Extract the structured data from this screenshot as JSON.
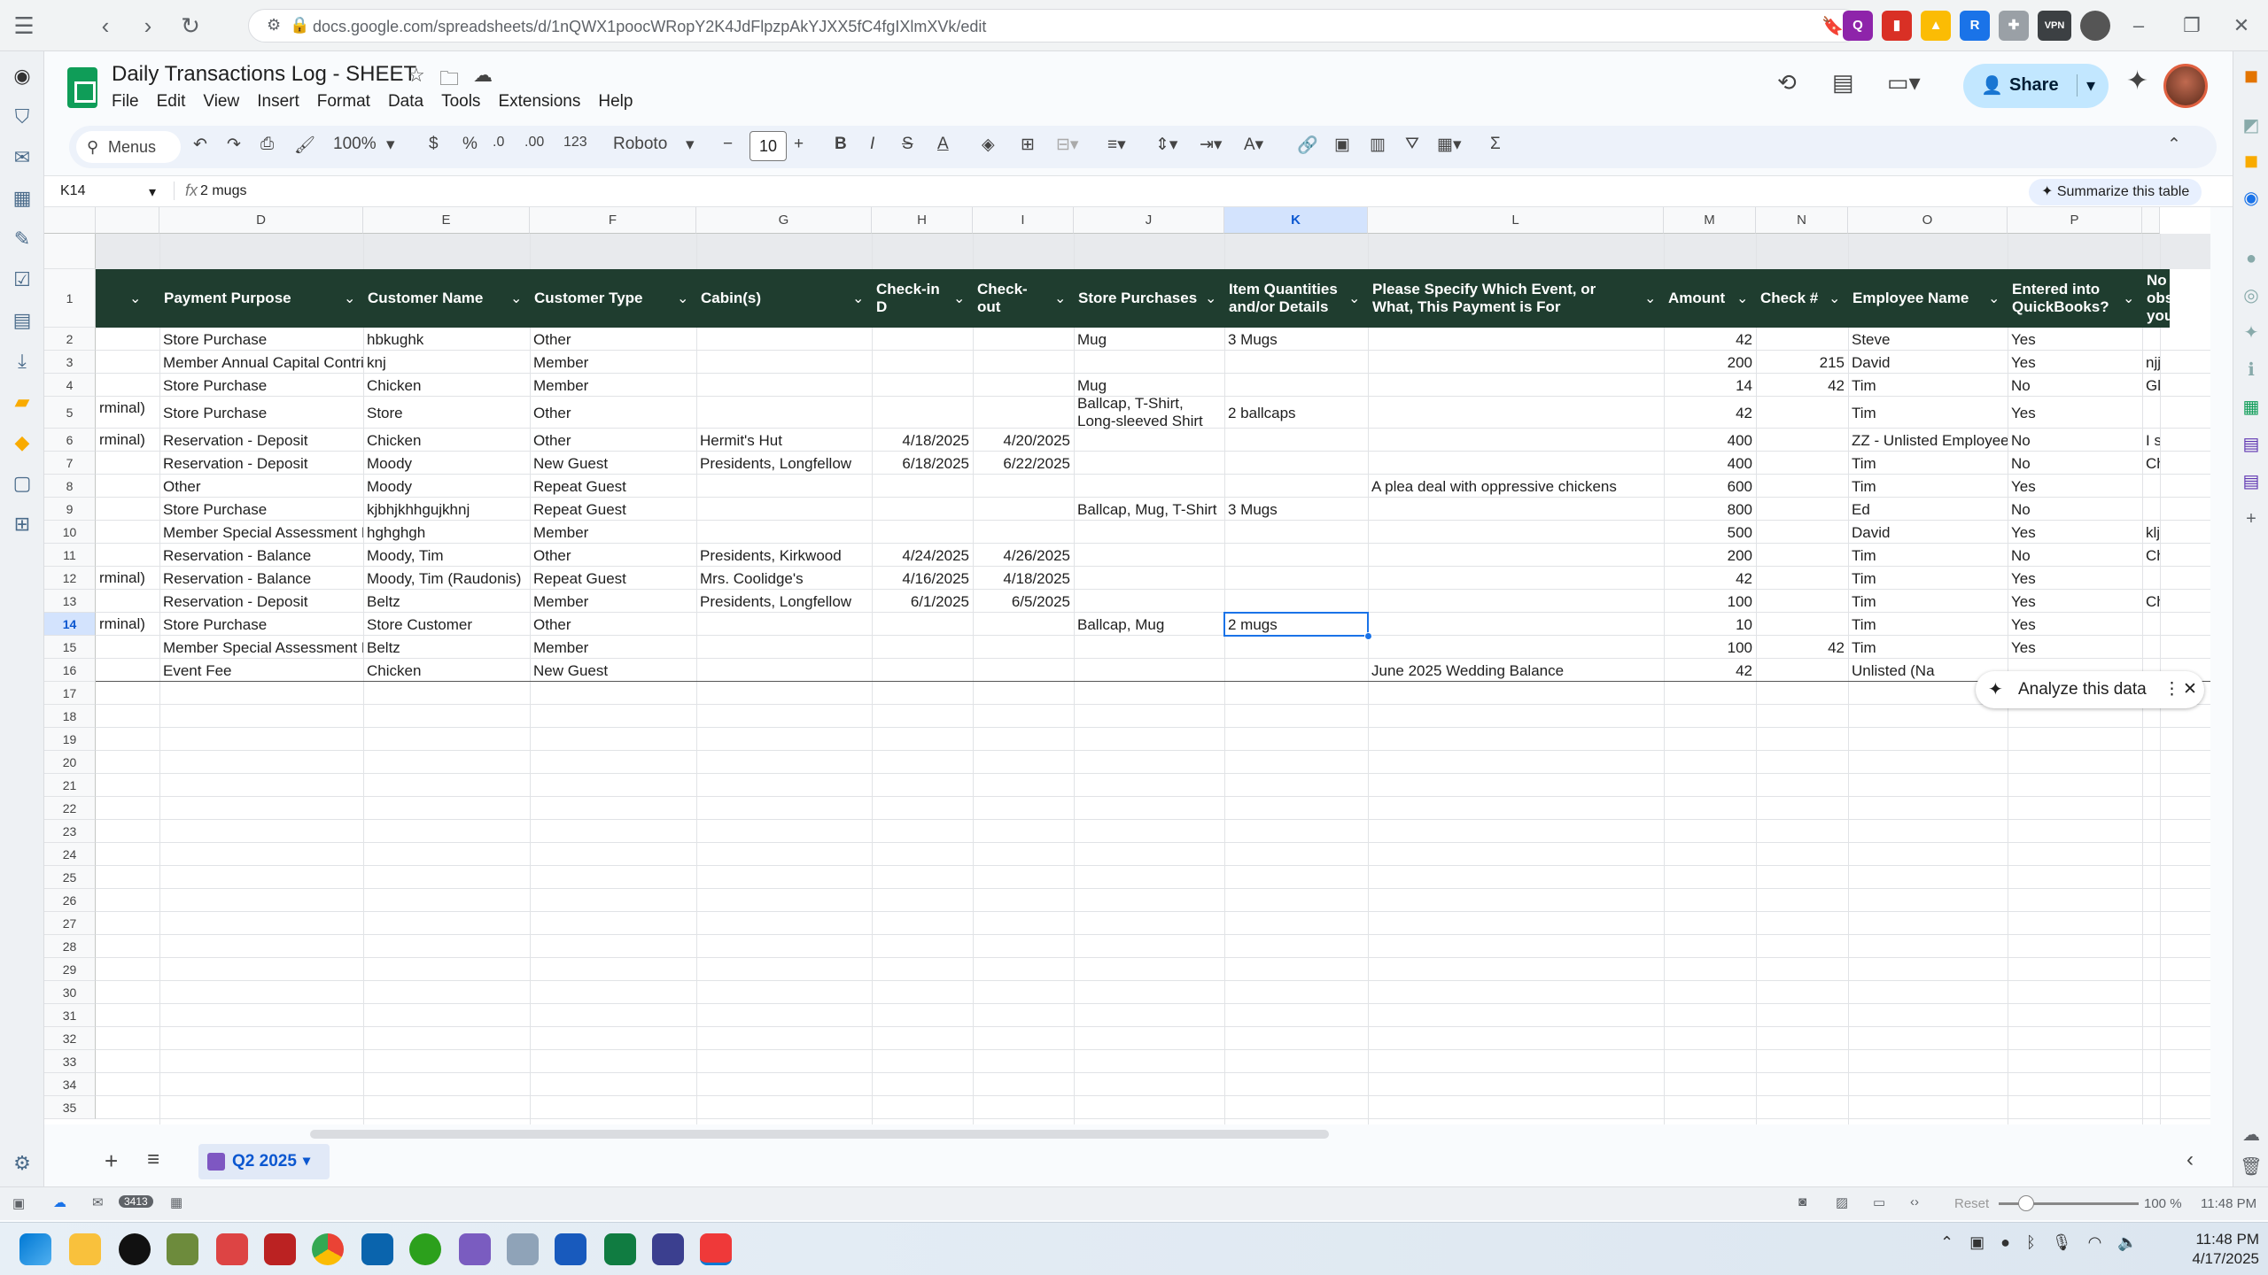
{
  "browser": {
    "url": "docs.google.com/spreadsheets/d/1nQWX1poocWRopY2K4JdFlpzpAkYJXX5fC4fgIXlmXVk/edit",
    "extensions": [
      "VPN"
    ]
  },
  "doc": {
    "title": "Daily Transactions Log - SHEET",
    "menus": [
      "File",
      "Edit",
      "View",
      "Insert",
      "Format",
      "Data",
      "Tools",
      "Extensions",
      "Help"
    ],
    "share_label": "Share"
  },
  "toolbar": {
    "menus_label": "Menus",
    "zoom": "100%",
    "currency": "$",
    "percent": "%",
    "dec_less": ".0",
    "dec_more": ".00",
    "num_format": "123",
    "font": "Roboto",
    "font_size": "10",
    "bold": "B",
    "italic": "I",
    "sum": "Σ"
  },
  "formula_bar": {
    "cell_ref": "K14",
    "fx": "fx",
    "content": "2 mugs",
    "summarize_label": "Summarize this table"
  },
  "grid": {
    "columns": [
      {
        "letter": "D",
        "header": "Payment Purpose"
      },
      {
        "letter": "E",
        "header": "Customer Name"
      },
      {
        "letter": "F",
        "header": "Customer Type"
      },
      {
        "letter": "G",
        "header": "Cabin(s)"
      },
      {
        "letter": "H",
        "header": "Check-in D"
      },
      {
        "letter": "I",
        "header": "Check-out"
      },
      {
        "letter": "J",
        "header": "Store Purchases"
      },
      {
        "letter": "K",
        "header": "Item Quantities and/or Details"
      },
      {
        "letter": "L",
        "header": "Please Specify Which Event, or What, This Payment is For"
      },
      {
        "letter": "M",
        "header": "Amount"
      },
      {
        "letter": "N",
        "header": "Check #"
      },
      {
        "letter": "O",
        "header": "Employee Name"
      },
      {
        "letter": "P",
        "header": "Entered into QuickBooks?"
      },
      {
        "letter": "",
        "header": "No obs you"
      }
    ],
    "selected_column": "K",
    "selected_row": "14",
    "rows": [
      {
        "n": "2",
        "c": "",
        "d": "Store Purchase",
        "e": "hbkughk",
        "f": "Other",
        "g": "",
        "h": "",
        "i": "",
        "j": "Mug",
        "k": "3 Mugs",
        "l": "",
        "m": "42",
        "nn": "",
        "o": "Steve",
        "p": "Yes",
        "q": ""
      },
      {
        "n": "3",
        "c": "",
        "d": "Member Annual Capital Contribution",
        "e": "knj",
        "f": "Member",
        "g": "",
        "h": "",
        "i": "",
        "j": "",
        "k": "",
        "l": "",
        "m": "200",
        "nn": "215",
        "o": "David",
        "p": "Yes",
        "q": "njjh"
      },
      {
        "n": "4",
        "c": "",
        "d": "Store Purchase",
        "e": "Chicken",
        "f": "Member",
        "g": "",
        "h": "",
        "i": "",
        "j": "Mug",
        "k": "",
        "l": "",
        "m": "14",
        "nn": "42",
        "o": "Tim",
        "p": "No",
        "q": "Glit"
      },
      {
        "n": "5",
        "c": "rminal)",
        "d": "Store Purchase",
        "e": "Store",
        "f": "Other",
        "g": "",
        "h": "",
        "i": "",
        "j": "Ballcap, T-Shirt, Long-sleeved Shirt",
        "k": "2 ballcaps",
        "l": "",
        "m": "42",
        "nn": "",
        "o": "Tim",
        "p": "Yes",
        "q": ""
      },
      {
        "n": "6",
        "c": "rminal)",
        "d": "Reservation - Deposit",
        "e": "Chicken",
        "f": "Other",
        "g": "Hermit's Hut",
        "h": "4/18/2025",
        "i": "4/20/2025",
        "j": "",
        "k": "",
        "l": "",
        "m": "400",
        "nn": "",
        "o": "ZZ - Unlisted Employee,",
        "p": "No",
        "q": "I sa"
      },
      {
        "n": "7",
        "c": "",
        "d": "Reservation - Deposit",
        "e": "Moody",
        "f": "New Guest",
        "g": "Presidents, Longfellow",
        "h": "6/18/2025",
        "i": "6/22/2025",
        "j": "",
        "k": "",
        "l": "",
        "m": "400",
        "nn": "",
        "o": "Tim",
        "p": "No",
        "q": "Chi"
      },
      {
        "n": "8",
        "c": "",
        "d": "Other",
        "e": "Moody",
        "f": "Repeat Guest",
        "g": "",
        "h": "",
        "i": "",
        "j": "",
        "k": "",
        "l": "A plea deal with oppressive chickens",
        "m": "600",
        "nn": "",
        "o": "Tim",
        "p": "Yes",
        "q": ""
      },
      {
        "n": "9",
        "c": "",
        "d": "Store Purchase",
        "e": "kjbhjkhhgujkhnj",
        "f": "Repeat Guest",
        "g": "",
        "h": "",
        "i": "",
        "j": "Ballcap, Mug, T-Shirt",
        "k": "3 Mugs",
        "l": "",
        "m": "800",
        "nn": "",
        "o": "Ed",
        "p": "No",
        "q": ""
      },
      {
        "n": "10",
        "c": "",
        "d": "Member Special Assessment Fee",
        "e": "hghghgh",
        "f": "Member",
        "g": "",
        "h": "",
        "i": "",
        "j": "",
        "k": "",
        "l": "",
        "m": "500",
        "nn": "",
        "o": "David",
        "p": "Yes",
        "q": "kljg"
      },
      {
        "n": "11",
        "c": "",
        "d": "Reservation - Balance",
        "e": "Moody, Tim",
        "f": "Other",
        "g": "Presidents, Kirkwood",
        "h": "4/24/2025",
        "i": "4/26/2025",
        "j": "",
        "k": "",
        "l": "",
        "m": "200",
        "nn": "",
        "o": "Tim",
        "p": "No",
        "q": "Chi"
      },
      {
        "n": "12",
        "c": "rminal)",
        "d": "Reservation - Balance",
        "e": "Moody, Tim (Raudonis)",
        "f": "Repeat Guest",
        "g": "Mrs. Coolidge's",
        "h": "4/16/2025",
        "i": "4/18/2025",
        "j": "",
        "k": "",
        "l": "",
        "m": "42",
        "nn": "",
        "o": "Tim",
        "p": "Yes",
        "q": ""
      },
      {
        "n": "13",
        "c": "",
        "d": "Reservation - Deposit",
        "e": "Beltz",
        "f": "Member",
        "g": "Presidents, Longfellow",
        "h": "6/1/2025",
        "i": "6/5/2025",
        "j": "",
        "k": "",
        "l": "",
        "m": "100",
        "nn": "",
        "o": "Tim",
        "p": "Yes",
        "q": "Chi"
      },
      {
        "n": "14",
        "c": "rminal)",
        "d": "Store Purchase",
        "e": "Store Customer",
        "f": "Other",
        "g": "",
        "h": "",
        "i": "",
        "j": "Ballcap, Mug",
        "k": "2 mugs",
        "l": "",
        "m": "10",
        "nn": "",
        "o": "Tim",
        "p": "Yes",
        "q": ""
      },
      {
        "n": "15",
        "c": "",
        "d": "Member Special Assessment Fee",
        "e": "Beltz",
        "f": "Member",
        "g": "",
        "h": "",
        "i": "",
        "j": "",
        "k": "",
        "l": "",
        "m": "100",
        "nn": "42",
        "o": "Tim",
        "p": "Yes",
        "q": ""
      },
      {
        "n": "16",
        "c": "",
        "d": "Event Fee",
        "e": "Chicken",
        "f": "New Guest",
        "g": "",
        "h": "",
        "i": "",
        "j": "",
        "k": "",
        "l": "June 2025 Wedding Balance",
        "m": "42",
        "nn": "",
        "o": "Unlisted (Na",
        "p": "",
        "q": ""
      }
    ],
    "empty_rows": [
      "17",
      "18",
      "19",
      "20",
      "21",
      "22",
      "23",
      "24",
      "25",
      "26",
      "27",
      "28",
      "29",
      "30",
      "31",
      "32",
      "33",
      "34",
      "35"
    ],
    "header_row_number": "1"
  },
  "analyze_chip": {
    "label": "Analyze this data"
  },
  "sheet_tabs": {
    "active": "Q2 2025"
  },
  "status": {
    "badge": "3413",
    "reset": "Reset",
    "zoom": "100 %",
    "time": "11:48 PM"
  },
  "taskbar": {
    "time": "11:48 PM",
    "date": "4/17/2025"
  }
}
